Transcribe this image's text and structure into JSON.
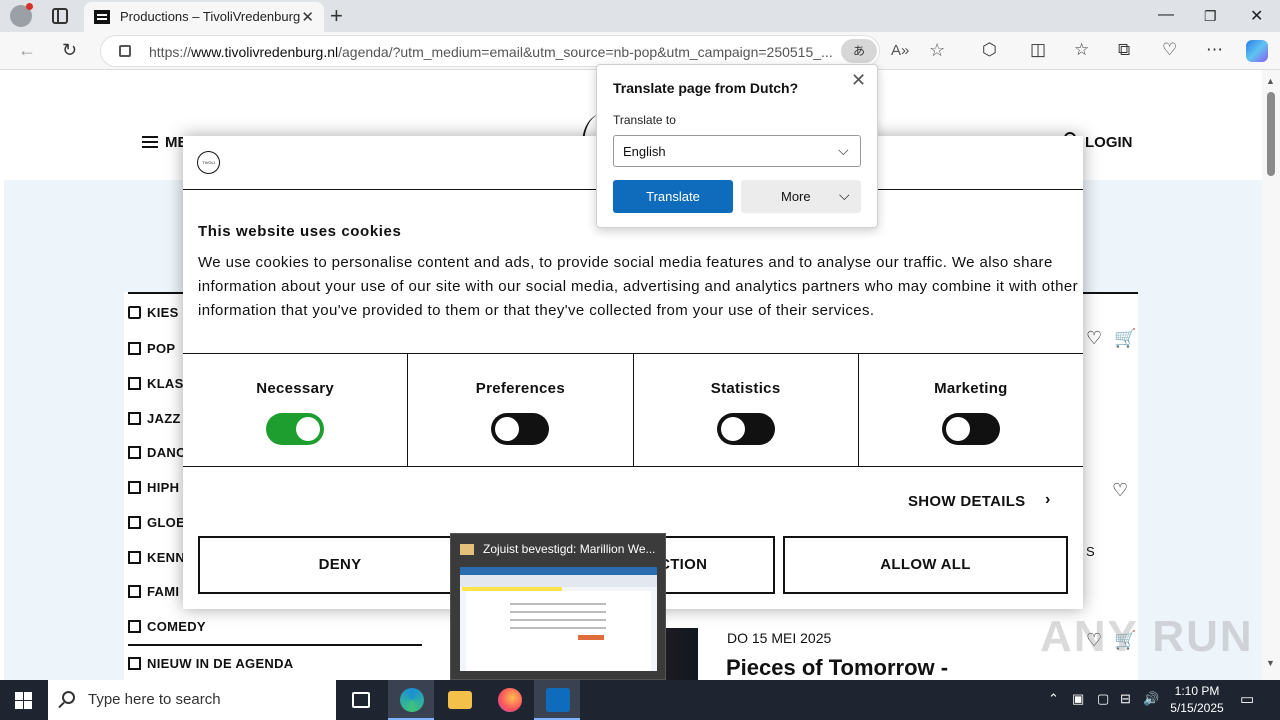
{
  "browser": {
    "tab_title": "Productions – TivoliVredenburg",
    "url_prefix": "https://",
    "url_domain": "www.tivolivredenburg.nl",
    "url_rest": "/agenda/?utm_medium=email&utm_source=nb-pop&utm_campaign=250515_...",
    "translate_icon": "あ",
    "icons": [
      "profile-icon",
      "tab-actions-icon",
      "back-icon",
      "refresh-icon",
      "lock-icon",
      "translate-icon",
      "read-aloud-icon",
      "favorite-star-icon",
      "extensions-icon",
      "split-screen-icon",
      "favorites-icon",
      "collections-icon",
      "performance-icon",
      "more-icon",
      "copilot-icon"
    ]
  },
  "translate_popup": {
    "title": "Translate page from Dutch?",
    "translate_to_label": "Translate to",
    "language": "English",
    "translate_button": "Translate",
    "more_button": "More"
  },
  "page": {
    "menu_label": "ME",
    "login_label": "LOGIN",
    "filters": [
      "KIES",
      "POP",
      "KLAS",
      "JAZZ",
      "DANC",
      "HIPH",
      "GLOE",
      "KENN",
      "FAMI",
      "COMEDY",
      "NIEUW IN DE AGENDA"
    ],
    "event": {
      "date": "DO 15 MEI 2025",
      "title": "Pieces of Tomorrow -",
      "partial_text": "S"
    }
  },
  "cookie_dialog": {
    "logo_text": "TIVOLI",
    "heading": "This website uses cookies",
    "body": "We use cookies to personalise content and ads, to provide social media features and to analyse our traffic. We also share information about your use of our site with our social media, advertising and analytics partners who may combine it with other information that you've provided to them or that they've collected from your use of their services.",
    "categories": [
      {
        "label": "Necessary",
        "enabled": true
      },
      {
        "label": "Preferences",
        "enabled": false
      },
      {
        "label": "Statistics",
        "enabled": false
      },
      {
        "label": "Marketing",
        "enabled": false
      }
    ],
    "show_details": "SHOW DETAILS",
    "deny_button": "DENY",
    "allow_selection_button": "ALLOW SELECTION",
    "allow_all_button": "ALLOW ALL"
  },
  "taskbar_thumbnail": {
    "title": "Zojuist bevestigd: Marillion We..."
  },
  "watermark": "ANY RUN",
  "taskbar": {
    "search_placeholder": "Type here to search",
    "time": "1:10 PM",
    "date": "5/15/2025",
    "apps": [
      "task-view-icon",
      "edge-icon",
      "file-explorer-icon",
      "firefox-icon",
      "outlook-icon"
    ],
    "tray_icons": [
      "chevron-up-icon",
      "outlook-tray-icon",
      "device-icon",
      "network-icon",
      "volume-icon",
      "notification-icon"
    ]
  },
  "colors": {
    "toggle_on": "#1e9e2f",
    "translate_button": "#0f6cbd",
    "taskbar": "#1f2530",
    "page_background": "#eef5fa"
  }
}
